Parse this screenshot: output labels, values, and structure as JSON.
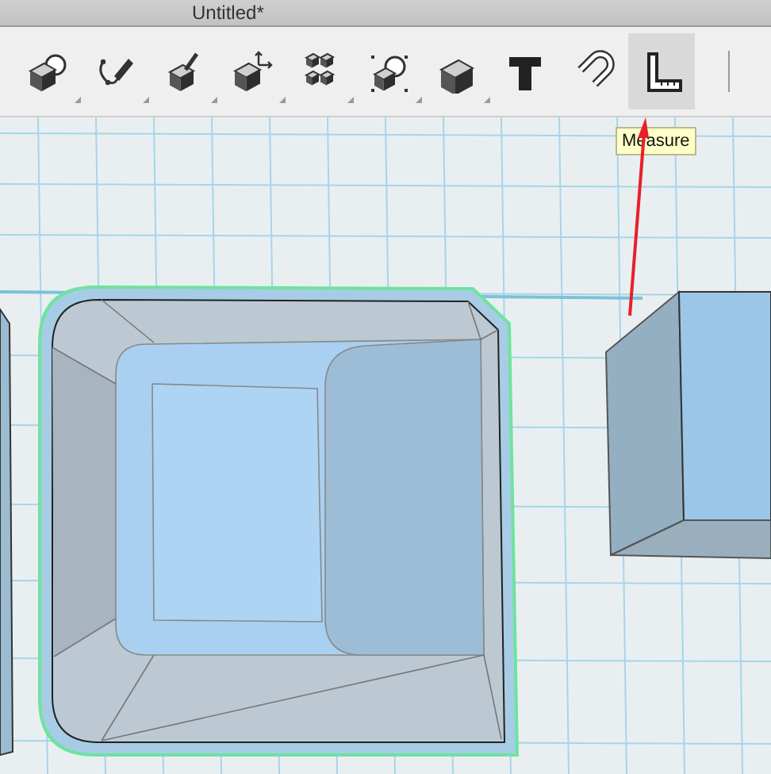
{
  "window": {
    "title": "Untitled*"
  },
  "toolbar": {
    "tools": [
      {
        "kind": "primitives",
        "selected": false,
        "has_menu": true
      },
      {
        "kind": "sketch",
        "selected": false,
        "has_menu": true
      },
      {
        "kind": "construct",
        "selected": false,
        "has_menu": true
      },
      {
        "kind": "transform",
        "selected": false,
        "has_menu": true
      },
      {
        "kind": "pattern",
        "selected": false,
        "has_menu": true
      },
      {
        "kind": "grouping",
        "selected": false,
        "has_menu": true
      },
      {
        "kind": "combine",
        "selected": false,
        "has_menu": true
      },
      {
        "kind": "text",
        "selected": false,
        "has_menu": false
      },
      {
        "kind": "snap",
        "selected": false,
        "has_menu": false
      },
      {
        "kind": "measure",
        "selected": true,
        "has_menu": false
      }
    ]
  },
  "tooltip": {
    "text": "Measure"
  }
}
